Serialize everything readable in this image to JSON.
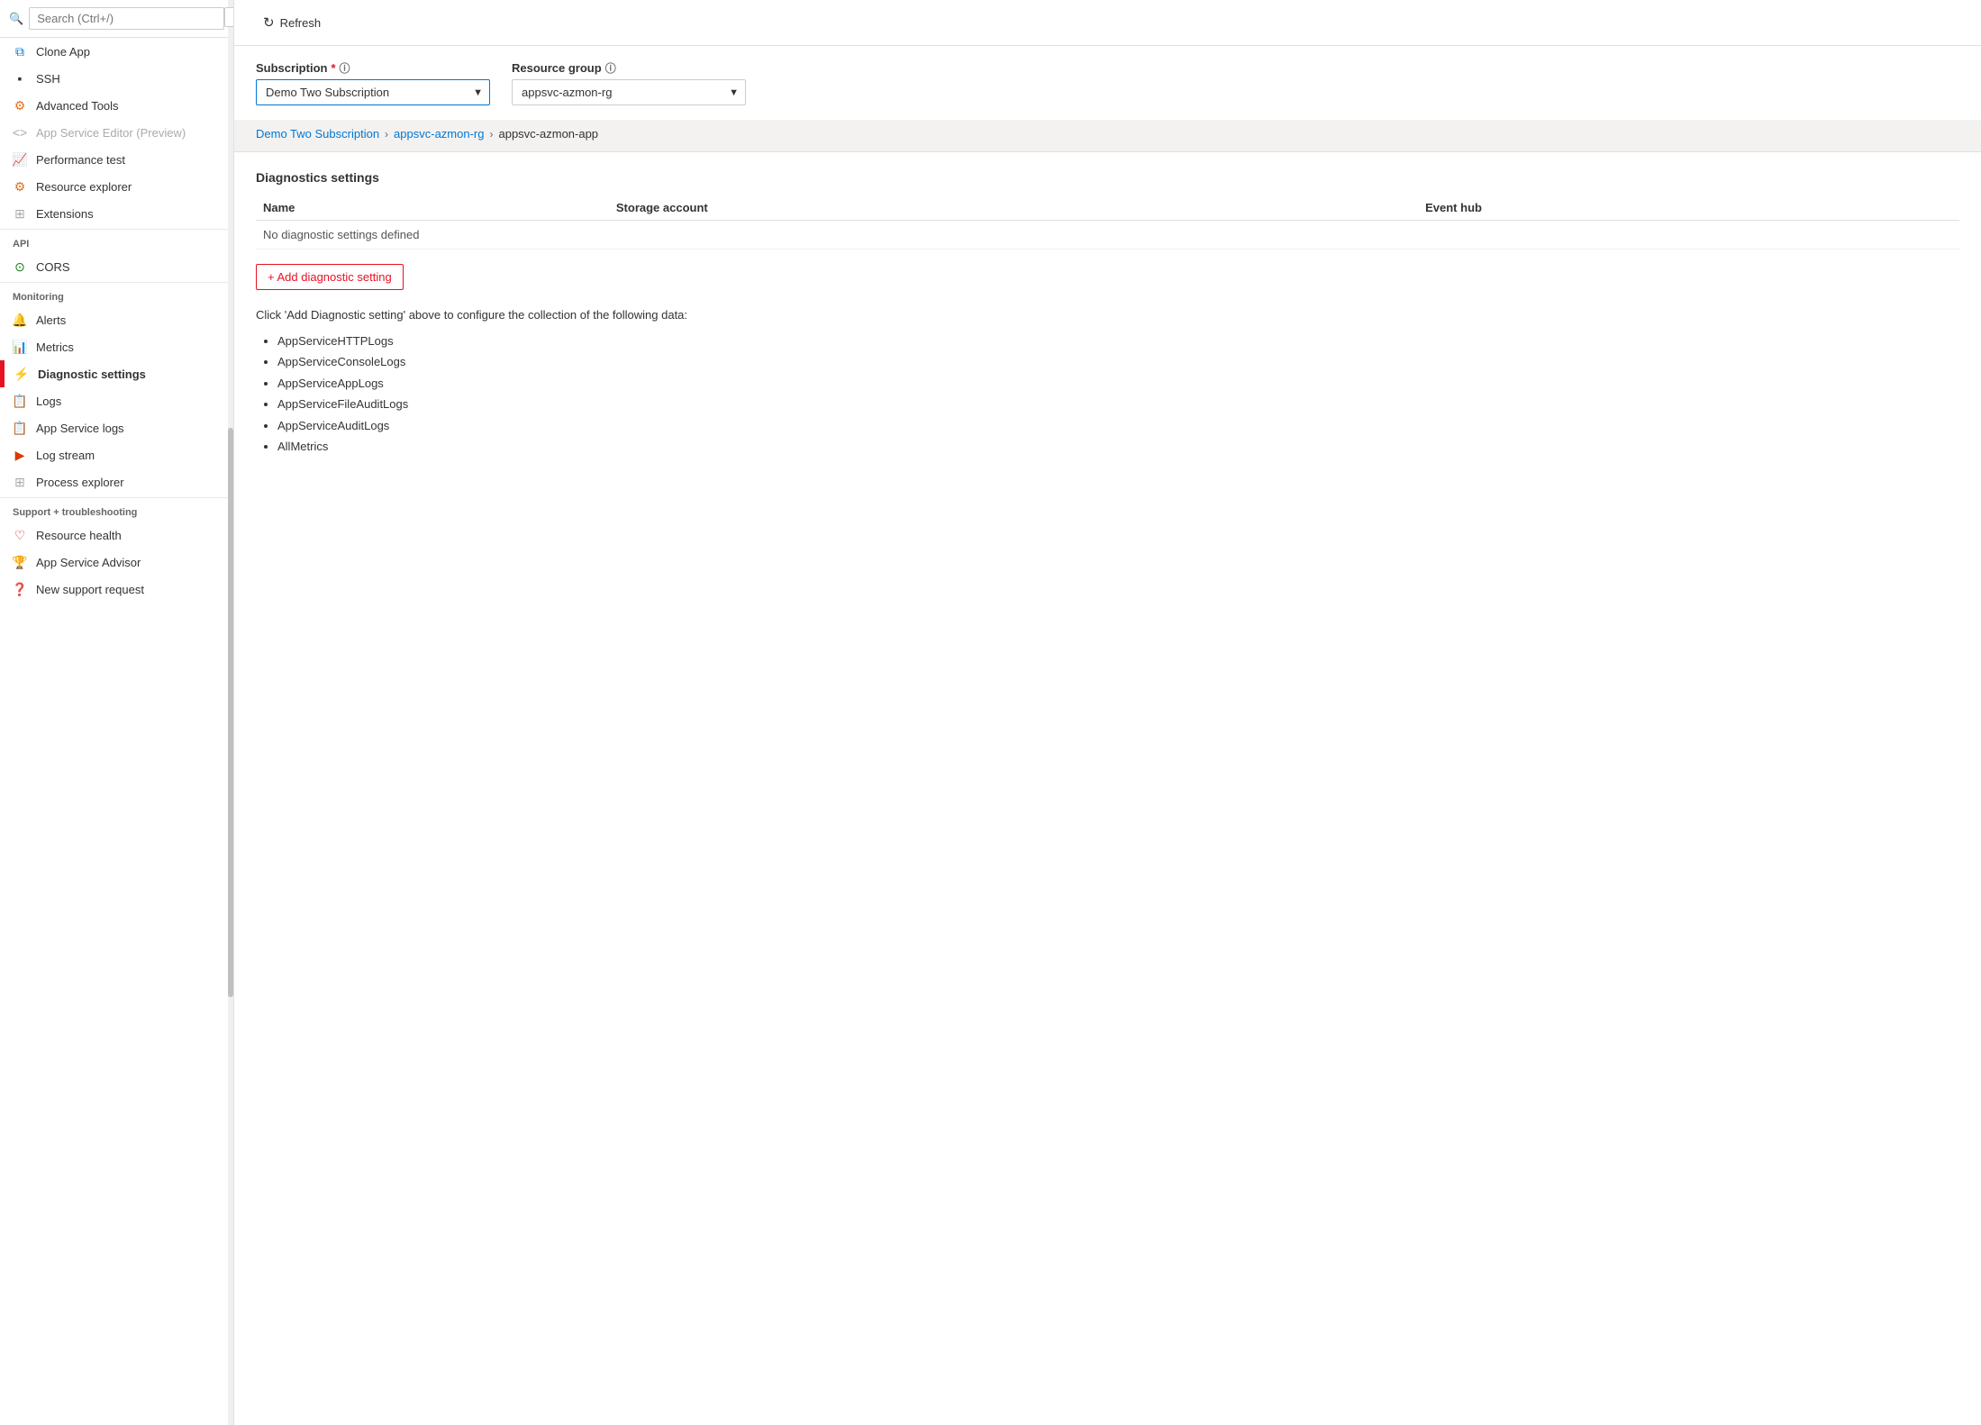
{
  "sidebar": {
    "search_placeholder": "Search (Ctrl+/)",
    "items": [
      {
        "id": "clone-app",
        "label": "Clone App",
        "icon": "clone",
        "section": null,
        "disabled": false,
        "active": false
      },
      {
        "id": "ssh",
        "label": "SSH",
        "icon": "ssh",
        "section": null,
        "disabled": false,
        "active": false
      },
      {
        "id": "advanced-tools",
        "label": "Advanced Tools",
        "icon": "tools",
        "section": null,
        "disabled": false,
        "active": false
      },
      {
        "id": "app-service-editor",
        "label": "App Service Editor (Preview)",
        "icon": "editor",
        "section": null,
        "disabled": true,
        "active": false
      },
      {
        "id": "performance-test",
        "label": "Performance test",
        "icon": "perf",
        "section": null,
        "disabled": false,
        "active": false
      },
      {
        "id": "resource-explorer",
        "label": "Resource explorer",
        "icon": "resource-exp",
        "section": null,
        "disabled": false,
        "active": false
      },
      {
        "id": "extensions",
        "label": "Extensions",
        "icon": "extensions",
        "section": null,
        "disabled": false,
        "active": false
      },
      {
        "id": "cors",
        "label": "CORS",
        "icon": "cors",
        "section": "API",
        "disabled": false,
        "active": false
      },
      {
        "id": "alerts",
        "label": "Alerts",
        "icon": "alerts",
        "section": "Monitoring",
        "disabled": false,
        "active": false
      },
      {
        "id": "metrics",
        "label": "Metrics",
        "icon": "metrics",
        "section": null,
        "disabled": false,
        "active": false
      },
      {
        "id": "diagnostic-settings",
        "label": "Diagnostic settings",
        "icon": "diag",
        "section": null,
        "disabled": false,
        "active": true
      },
      {
        "id": "logs",
        "label": "Logs",
        "icon": "logs",
        "section": null,
        "disabled": false,
        "active": false
      },
      {
        "id": "app-service-logs",
        "label": "App Service logs",
        "icon": "appsvc-logs",
        "section": null,
        "disabled": false,
        "active": false
      },
      {
        "id": "log-stream",
        "label": "Log stream",
        "icon": "log-stream",
        "section": null,
        "disabled": false,
        "active": false
      },
      {
        "id": "process-explorer",
        "label": "Process explorer",
        "icon": "proc-exp",
        "section": null,
        "disabled": false,
        "active": false
      },
      {
        "id": "resource-health",
        "label": "Resource health",
        "icon": "res-health",
        "section": "Support + troubleshooting",
        "disabled": false,
        "active": false
      },
      {
        "id": "app-service-advisor",
        "label": "App Service Advisor",
        "icon": "advisor",
        "section": null,
        "disabled": false,
        "active": false
      },
      {
        "id": "new-support-request",
        "label": "New support request",
        "icon": "support",
        "section": null,
        "disabled": false,
        "active": false
      }
    ]
  },
  "toolbar": {
    "refresh_label": "Refresh"
  },
  "breadcrumb": {
    "subscription": "Demo Two Subscription",
    "resource_group": "appsvc-azmon-rg",
    "resource": "appsvc-azmon-app",
    "sep": "›"
  },
  "form": {
    "subscription_label": "Subscription",
    "subscription_required": "*",
    "subscription_value": "Demo Two Subscription",
    "resource_group_label": "Resource group",
    "resource_group_value": "appsvc-azmon-rg"
  },
  "diagnostics": {
    "section_title": "Diagnostics settings",
    "col_name": "Name",
    "col_storage": "Storage account",
    "col_eventhub": "Event hub",
    "no_settings_msg": "No diagnostic settings defined",
    "add_button_label": "+ Add diagnostic setting",
    "info_text": "Click 'Add Diagnostic setting' above to configure the collection of the following data:",
    "data_items": [
      "AppServiceHTTPLogs",
      "AppServiceConsoleLogs",
      "AppServiceAppLogs",
      "AppServiceFileAuditLogs",
      "AppServiceAuditLogs",
      "AllMetrics"
    ]
  }
}
